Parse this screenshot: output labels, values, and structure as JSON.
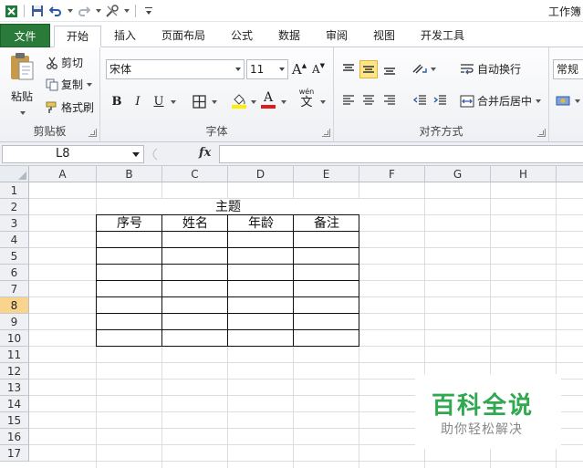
{
  "window": {
    "title": "工作簿"
  },
  "tabs": [
    {
      "label": "文件"
    },
    {
      "label": "开始"
    },
    {
      "label": "插入"
    },
    {
      "label": "页面布局"
    },
    {
      "label": "公式"
    },
    {
      "label": "数据"
    },
    {
      "label": "审阅"
    },
    {
      "label": "视图"
    },
    {
      "label": "开发工具"
    }
  ],
  "ribbon": {
    "clipboard": {
      "label": "剪贴板",
      "paste": "粘贴",
      "cut": "剪切",
      "copy": "复制",
      "format_painter": "格式刷"
    },
    "font": {
      "label": "字体",
      "font_name": "宋体",
      "font_size": "11",
      "bold": "B",
      "italic": "I",
      "underline": "U",
      "grow": "A",
      "shrink": "A",
      "font_color_glyph": "A",
      "phonetic_top": "wén",
      "phonetic_bottom": "文"
    },
    "alignment": {
      "label": "对齐方式",
      "wrap_text": "自动换行",
      "merge_center": "合并后居中"
    },
    "number": {
      "format": "常规"
    }
  },
  "formula_bar": {
    "name_box": "L8",
    "fx": "fx",
    "value": ""
  },
  "sheet": {
    "columns": [
      "A",
      "B",
      "C",
      "D",
      "E",
      "F",
      "G",
      "H"
    ],
    "rows": [
      "1",
      "2",
      "3",
      "4",
      "5",
      "6",
      "7",
      "8",
      "9",
      "10",
      "11",
      "12",
      "13",
      "14",
      "15",
      "16",
      "17"
    ],
    "selected_row": "8",
    "title_cell": "主题",
    "table_headers": [
      "序号",
      "姓名",
      "年龄",
      "备注"
    ]
  },
  "watermark": {
    "title": "百科全说",
    "subtitle": "助你轻松解决"
  },
  "colors": {
    "file_tab": "#2a7a3a",
    "selected_row": "#f8d48c",
    "watermark": "#2fa84f"
  }
}
